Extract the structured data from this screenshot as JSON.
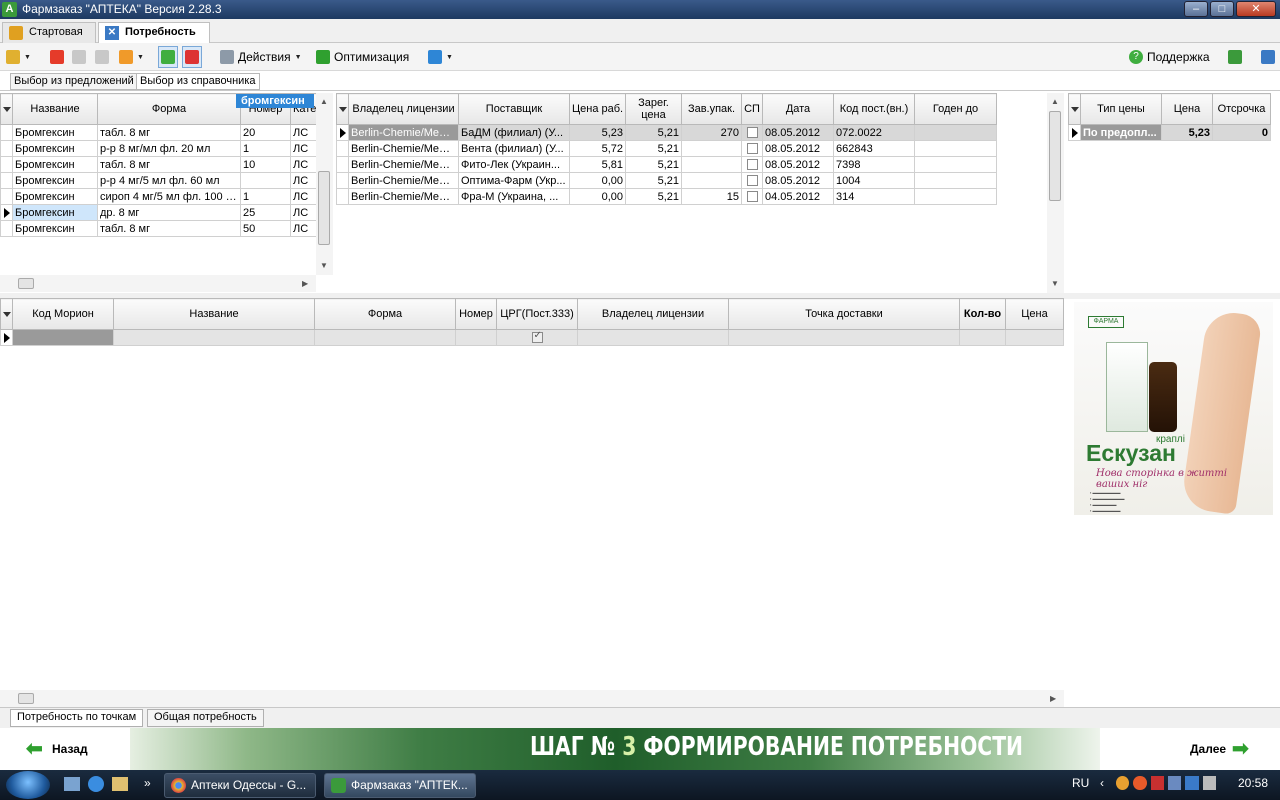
{
  "window": {
    "title": "Фармзаказ \"АПТЕКА\" Версия 2.28.3",
    "app_icon_letter": "A"
  },
  "tabs": [
    {
      "label": "Стартовая",
      "active": false
    },
    {
      "label": "Потребность",
      "active": true
    }
  ],
  "toolbar": {
    "actions_label": "Действия",
    "optimize_label": "Оптимизация",
    "support_label": "Поддержка"
  },
  "subtabs": [
    "Выбор из предложений",
    "Выбор из справочника"
  ],
  "search_tag": "бромгексин",
  "products": {
    "columns": [
      "Название",
      "Форма",
      "Номер",
      "Кате"
    ],
    "rows": [
      {
        "name": "Бромгексин",
        "form": "табл. 8 мг",
        "num": "20",
        "cat": "ЛС"
      },
      {
        "name": "Бромгексин",
        "form": "р-р 8 мг/мл фл. 20 мл",
        "num": "1",
        "cat": "ЛС"
      },
      {
        "name": "Бромгексин",
        "form": "табл. 8 мг",
        "num": "10",
        "cat": "ЛС"
      },
      {
        "name": "Бромгексин",
        "form": "р-р 4 мг/5 мл фл. 60 мл",
        "num": "",
        "cat": "ЛС"
      },
      {
        "name": "Бромгексин",
        "form": "сироп 4 мг/5 мл фл. 100 мл",
        "num": "1",
        "cat": "ЛС"
      },
      {
        "name": "Бромгексин",
        "form": "др. 8 мг",
        "num": "25",
        "cat": "ЛС"
      },
      {
        "name": "Бромгексин",
        "form": "табл. 8 мг",
        "num": "50",
        "cat": "ЛС"
      }
    ]
  },
  "offers": {
    "columns": [
      "Владелец лицензии",
      "Поставщик",
      "Цена раб.",
      "Зарег. цена",
      "Зав.упак.",
      "СП",
      "Дата",
      "Код пост.(вн.)",
      "Годен до"
    ],
    "rows": [
      {
        "owner": "Berlin-Chemie/Mena...",
        "supplier": "БаДМ (филиал) (У...",
        "price": "5,23",
        "reg": "5,21",
        "pack": "270",
        "sp": false,
        "date": "08.05.2012",
        "code": "072.0022",
        "exp": ""
      },
      {
        "owner": "Berlin-Chemie/Mena...",
        "supplier": "Вента (филиал) (У...",
        "price": "5,72",
        "reg": "5,21",
        "pack": "",
        "sp": false,
        "date": "08.05.2012",
        "code": "662843",
        "exp": ""
      },
      {
        "owner": "Berlin-Chemie/Mena...",
        "supplier": "Фито-Лек (Украин...",
        "price": "5,81",
        "reg": "5,21",
        "pack": "",
        "sp": false,
        "date": "08.05.2012",
        "code": "7398",
        "exp": ""
      },
      {
        "owner": "Berlin-Chemie/Mena...",
        "supplier": "Оптима-Фарм (Укр...",
        "price": "0,00",
        "reg": "5,21",
        "pack": "",
        "sp": false,
        "date": "08.05.2012",
        "code": "1004",
        "exp": ""
      },
      {
        "owner": "Berlin-Chemie/Mena...",
        "supplier": "Фра-М (Украина, ...",
        "price": "0,00",
        "reg": "5,21",
        "pack": "15",
        "sp": false,
        "date": "04.05.2012",
        "code": "314",
        "exp": ""
      }
    ]
  },
  "pricetypes": {
    "columns": [
      "Тип цены",
      "Цена",
      "Отсрочка"
    ],
    "rows": [
      {
        "type": "По предопл...",
        "price": "5,23",
        "delay": "0"
      }
    ]
  },
  "needs": {
    "columns": [
      "Код Морион",
      "Название",
      "Форма",
      "Номер",
      "ЦРГ(Пост.333)",
      "Владелец лицензии",
      "Точка доставки",
      "Кол-во",
      "Цена"
    ]
  },
  "ad": {
    "logo": "ФАРМА",
    "brand": "Ескузан",
    "drops": "краплі",
    "slogan": "Нова сторінка в житті ваших ніг"
  },
  "bottom_tabs": [
    "Потребность по точкам",
    "Общая потребность"
  ],
  "step": {
    "back": "Назад",
    "next": "Далее",
    "prefix": "ШАГ №",
    "number": "3",
    "title": "ФОРМИРОВАНИЕ ПОТРЕБНОСТИ"
  },
  "taskbar": {
    "items": [
      "Аптеки Одессы - G...",
      "Фармзаказ \"АПТЕК..."
    ],
    "lang": "RU",
    "clock": "20:58"
  },
  "colors": {
    "accent": "#2e86d6",
    "selected_row": "#d8d8d8",
    "current_cell": "#cfe6fb",
    "step_green": "#1f5e2a"
  }
}
